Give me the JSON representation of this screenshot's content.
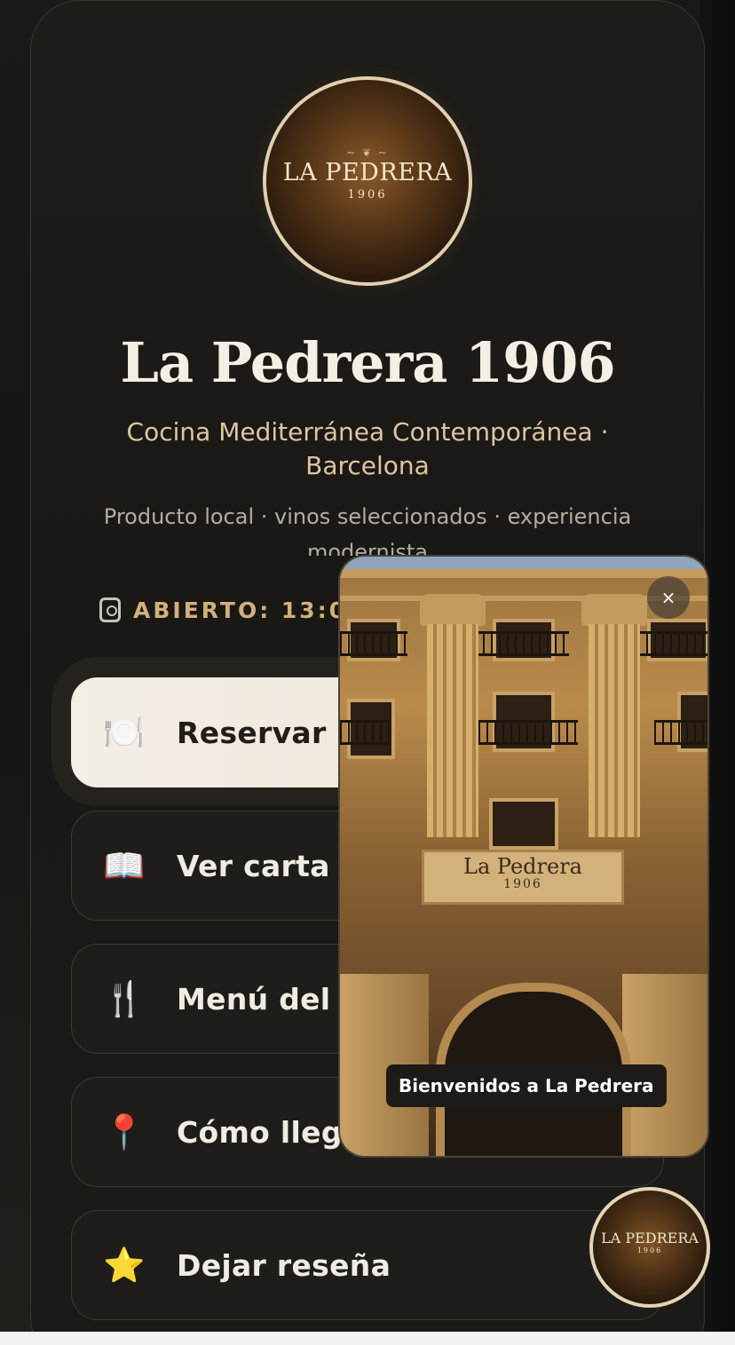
{
  "profile": {
    "avatar_text": "LA PEDRERA",
    "avatar_year": "1906",
    "name": "La Pedrera 1906",
    "subtitle": "Cocina Mediterránea Contemporánea · Barcelona",
    "tagline": "Producto local · vinos seleccionados · experiencia modernista",
    "hours": "ABIERTO: 13:00"
  },
  "links": [
    {
      "label": "Reservar me",
      "icon": "plate-icon",
      "glyph": "🍽️"
    },
    {
      "label": "Ver carta",
      "icon": "book-icon",
      "glyph": "📖"
    },
    {
      "label": "Menú del día",
      "icon": "fork-knife-icon",
      "glyph": "🍴"
    },
    {
      "label": "Cómo llegar",
      "icon": "pin-icon",
      "glyph": "📍"
    },
    {
      "label": "Dejar reseña",
      "icon": "star-icon",
      "glyph": "⭐"
    }
  ],
  "video": {
    "sign_name": "La Pedrera",
    "sign_year": "1906",
    "close_glyph": "×",
    "caption": "Bienvenidos a La Pedrera"
  },
  "fab": {
    "text": "LA PEDRERA",
    "year": "1906"
  },
  "colors": {
    "background": "#1b1917",
    "accent_gold": "#d2b07c",
    "primary_button": "#f3eee6"
  }
}
